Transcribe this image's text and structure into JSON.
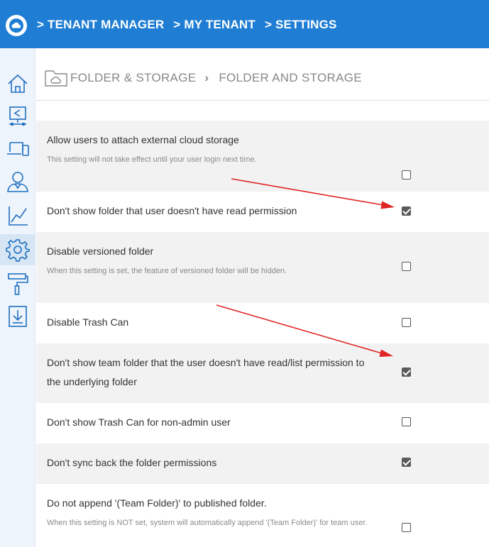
{
  "header": {
    "crumbs": [
      "> TENANT MANAGER",
      "> MY TENANT",
      "> SETTINGS"
    ]
  },
  "title": {
    "section": "FOLDER & STORAGE",
    "page": "FOLDER AND STORAGE"
  },
  "sidebar": {
    "items": [
      {
        "icon": "home-icon"
      },
      {
        "icon": "share-monitor-icon"
      },
      {
        "icon": "devices-icon"
      },
      {
        "icon": "user-icon"
      },
      {
        "icon": "chart-icon"
      },
      {
        "icon": "gear-icon",
        "active": true
      },
      {
        "icon": "paint-roller-icon"
      },
      {
        "icon": "download-icon"
      }
    ]
  },
  "settings": [
    {
      "label": "Allow users to attach external cloud storage",
      "desc": "This setting will not take effect until your user login next time.",
      "checked": false
    },
    {
      "label": "Don't show folder that user doesn't have read permission",
      "checked": true
    },
    {
      "label": "Disable versioned folder",
      "desc": "When this setting is set, the feature of versioned folder will be hidden.",
      "checked": false
    },
    {
      "label": "Disable Trash Can",
      "checked": false
    },
    {
      "label": "Don't show team folder that the user doesn't have read/list permission to the underlying folder",
      "checked": true
    },
    {
      "label": "Don't show Trash Can for non-admin user",
      "checked": false
    },
    {
      "label": "Don't sync back the folder permissions",
      "checked": true
    },
    {
      "label": "Do not append '(Team Folder)' to published folder.",
      "desc": "When this setting is NOT set, system will automatically append '(Team Folder)' for team user.",
      "checked": false
    }
  ],
  "colors": {
    "header": "#1f7ed4",
    "annotation_arrow": "#e02424"
  }
}
